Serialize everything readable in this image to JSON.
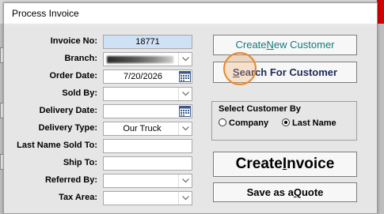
{
  "window": {
    "title": "Process Invoice"
  },
  "form": {
    "invoice_no": {
      "label": "Invoice No:",
      "value": "18771"
    },
    "branch": {
      "label": "Branch:"
    },
    "order_date": {
      "label": "Order Date:",
      "value": "7/20/2026"
    },
    "sold_by": {
      "label": "Sold By:",
      "value": ""
    },
    "delivery_date": {
      "label": "Delivery Date:",
      "value": ""
    },
    "delivery_type": {
      "label": "Delivery Type:",
      "value": "Our Truck"
    },
    "last_name_sold_to": {
      "label": "Last Name Sold To:",
      "value": ""
    },
    "ship_to": {
      "label": "Ship To:",
      "value": ""
    },
    "referred_by": {
      "label": "Referred By:",
      "value": ""
    },
    "tax_area": {
      "label": "Tax Area:",
      "value": ""
    }
  },
  "buttons": {
    "create_customer": {
      "pre": "Create ",
      "key": "N",
      "post": "ew Customer"
    },
    "search_customer": {
      "pre": "",
      "key": "S",
      "post": "earch For Customer"
    },
    "create_invoice": {
      "pre": "Create ",
      "key": "I",
      "post": "nvoice"
    },
    "save_quote": {
      "pre": "Save as a ",
      "key": "Q",
      "post": "uote"
    }
  },
  "select_customer": {
    "title": "Select Customer By",
    "options": [
      {
        "label": "Company",
        "selected": false
      },
      {
        "label": "Last Name",
        "selected": true
      }
    ]
  },
  "colors": {
    "invoice_field_bg": "#cfe2f5",
    "create_customer_text": "#147b7b",
    "search_customer_text": "#1d2a58",
    "cursor_highlight": "#e8872a"
  },
  "icons": [
    "chevron-down-icon",
    "calendar-icon",
    "radio-icon"
  ]
}
